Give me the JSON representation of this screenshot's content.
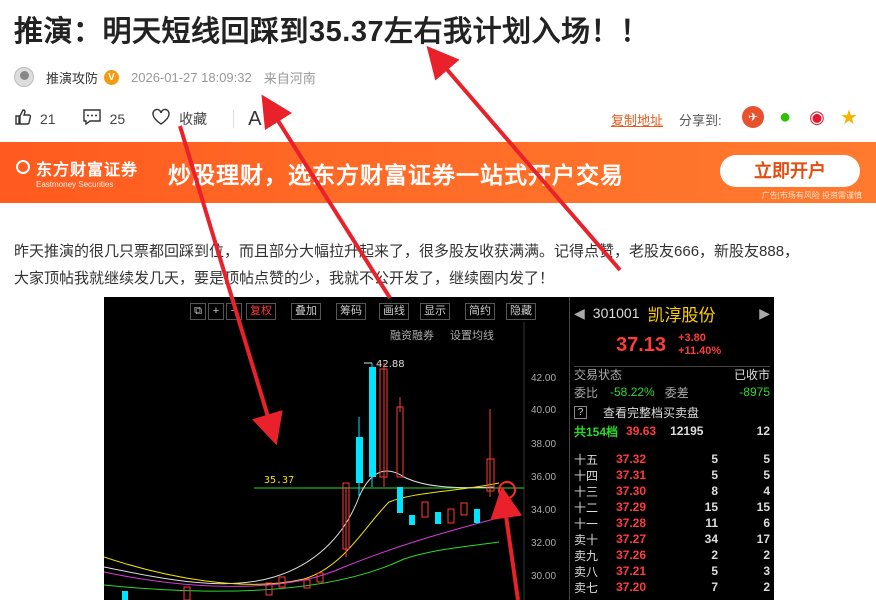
{
  "article": {
    "title": "推演：明天短线回踩到35.37左右我计划入场！！",
    "author": "推演攻防",
    "verified_badge": "V",
    "datetime": "2026-01-27 18:09:32",
    "location": "来自河南",
    "paragraph_line1": "昨天推演的很几只票都回踩到位，而且部分大幅拉升起来了，很多股友收获满满。记得点赞，老股友666，新股友888，",
    "paragraph_line2": "大家顶帖我就继续发几天，要是顶帖点赞的少，我就不公开发了，继续圈内发了！"
  },
  "actions": {
    "likes": "21",
    "comments": "25",
    "favorite_label": "收藏",
    "font_label": "A",
    "copy_link": "复制地址",
    "share_label": "分享到:"
  },
  "banner": {
    "logo_cn": "东方财富证券",
    "logo_en": "Eastmoney Securities",
    "slogan": "炒股理财，选东方财富证券一站式开户交易",
    "button": "立即开户",
    "note": "广告|市场有风险 投资需谨慎"
  },
  "stock": {
    "toolbar": [
      "复权",
      "叠加",
      "筹码",
      "画线",
      "显示",
      "简约",
      "隐藏"
    ],
    "sub_toolbar": [
      "融资融券",
      "设置均线"
    ],
    "code": "301001",
    "name": "凯淳股份",
    "price": "37.13",
    "change": "+3.80",
    "change_pct": "+11.40%",
    "status_label": "交易状态",
    "status_value": "已收市",
    "ratio_label": "委比",
    "ratio_value": "-58.22%",
    "diff_label": "委差",
    "diff_value": "-8975",
    "full_queue": "查看完整档买卖盘",
    "level_label": "共154档",
    "level_price": "39.63",
    "level_vol": "12195",
    "level_count": "12",
    "y_ticks": [
      "42.00",
      "40.00",
      "38.00",
      "36.00",
      "34.00",
      "32.00",
      "30.00"
    ],
    "high_label": "42.88",
    "support_label": "35.37",
    "asks": [
      {
        "label": "十五",
        "price": "37.32",
        "vol": "5",
        "n": "5"
      },
      {
        "label": "十四",
        "price": "37.31",
        "vol": "5",
        "n": "5"
      },
      {
        "label": "十三",
        "price": "37.30",
        "vol": "8",
        "n": "4"
      },
      {
        "label": "十二",
        "price": "37.29",
        "vol": "15",
        "n": "15"
      },
      {
        "label": "十一",
        "price": "37.28",
        "vol": "11",
        "n": "6"
      },
      {
        "label": "卖十",
        "price": "37.27",
        "vol": "34",
        "n": "17"
      },
      {
        "label": "卖九",
        "price": "37.26",
        "vol": "2",
        "n": "2"
      },
      {
        "label": "卖八",
        "price": "37.21",
        "vol": "5",
        "n": "3"
      },
      {
        "label": "卖七",
        "price": "37.20",
        "vol": "7",
        "n": "2"
      }
    ]
  },
  "colors": {
    "accent": "#ff5a1f",
    "up": "#ff3b3b",
    "down": "#00e5ff",
    "ma_yellow": "#f2e205"
  }
}
